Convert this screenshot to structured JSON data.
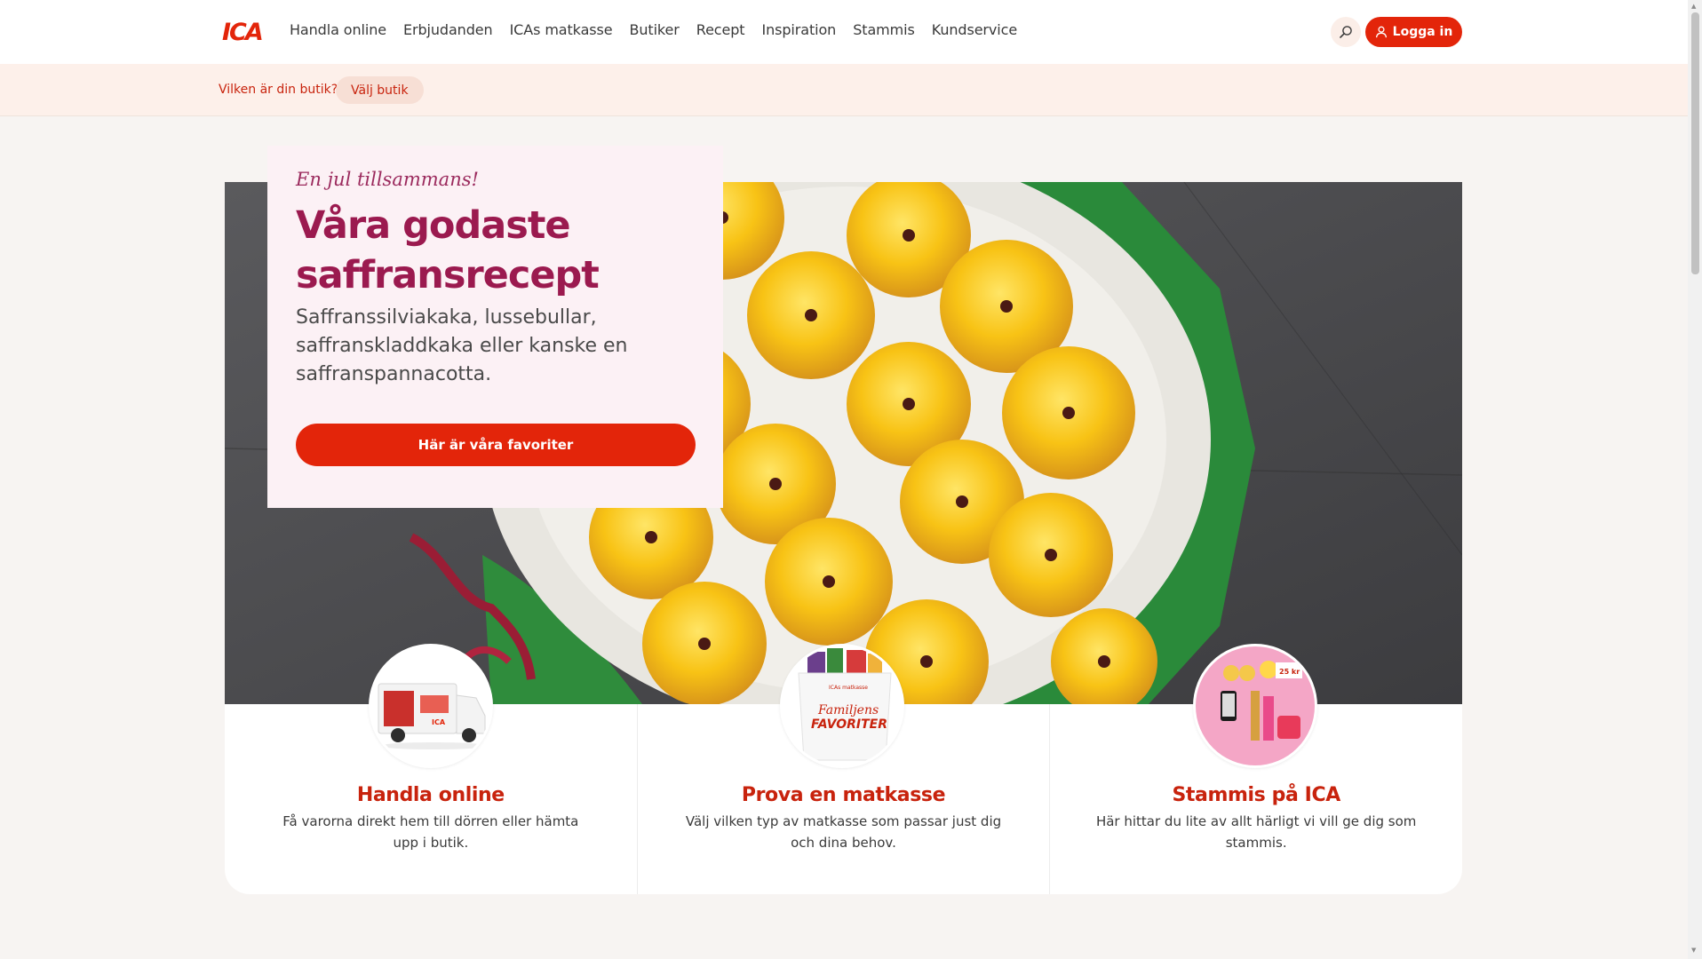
{
  "header": {
    "logo": "ICA",
    "nav": [
      "Handla online",
      "Erbjudanden",
      "ICAs matkasse",
      "Butiker",
      "Recept",
      "Inspiration",
      "Stammis",
      "Kundservice"
    ],
    "search_icon": "search-icon",
    "login_label": "Logga in",
    "brand_color": "#e3250a"
  },
  "storebar": {
    "question": "Vilken är din butik?",
    "pick_label": "Välj butik"
  },
  "hero": {
    "kicker": "En jul tillsammans!",
    "title": "Våra godaste saffransrecept",
    "text": "Saffranssilviakaka, lussebullar, saffranskladdkaka eller kanske en saffranspannacotta.",
    "cta": "Här är våra favoriter",
    "title_color": "#9b1a4f"
  },
  "cards": [
    {
      "title": "Handla online",
      "text": "Få varorna direkt hem till dörren eller hämta upp i butik.",
      "image": "delivery-truck"
    },
    {
      "title": "Prova en matkasse",
      "text": "Välj vilken typ av matkasse som passar just dig och dina behov.",
      "image": "grocery-bag"
    },
    {
      "title": "Stammis på ICA",
      "text": "Här hittar du lite av allt härligt vi vill ge dig som stammis.",
      "image": "stammis-items"
    }
  ],
  "truck_text": {
    "brand": "ICA"
  },
  "bag_text": {
    "brand": "ICAs matkasse",
    "line1": "Familjens",
    "line2": "FAVORITER"
  },
  "stammis_text": {
    "price": "25 kr"
  }
}
